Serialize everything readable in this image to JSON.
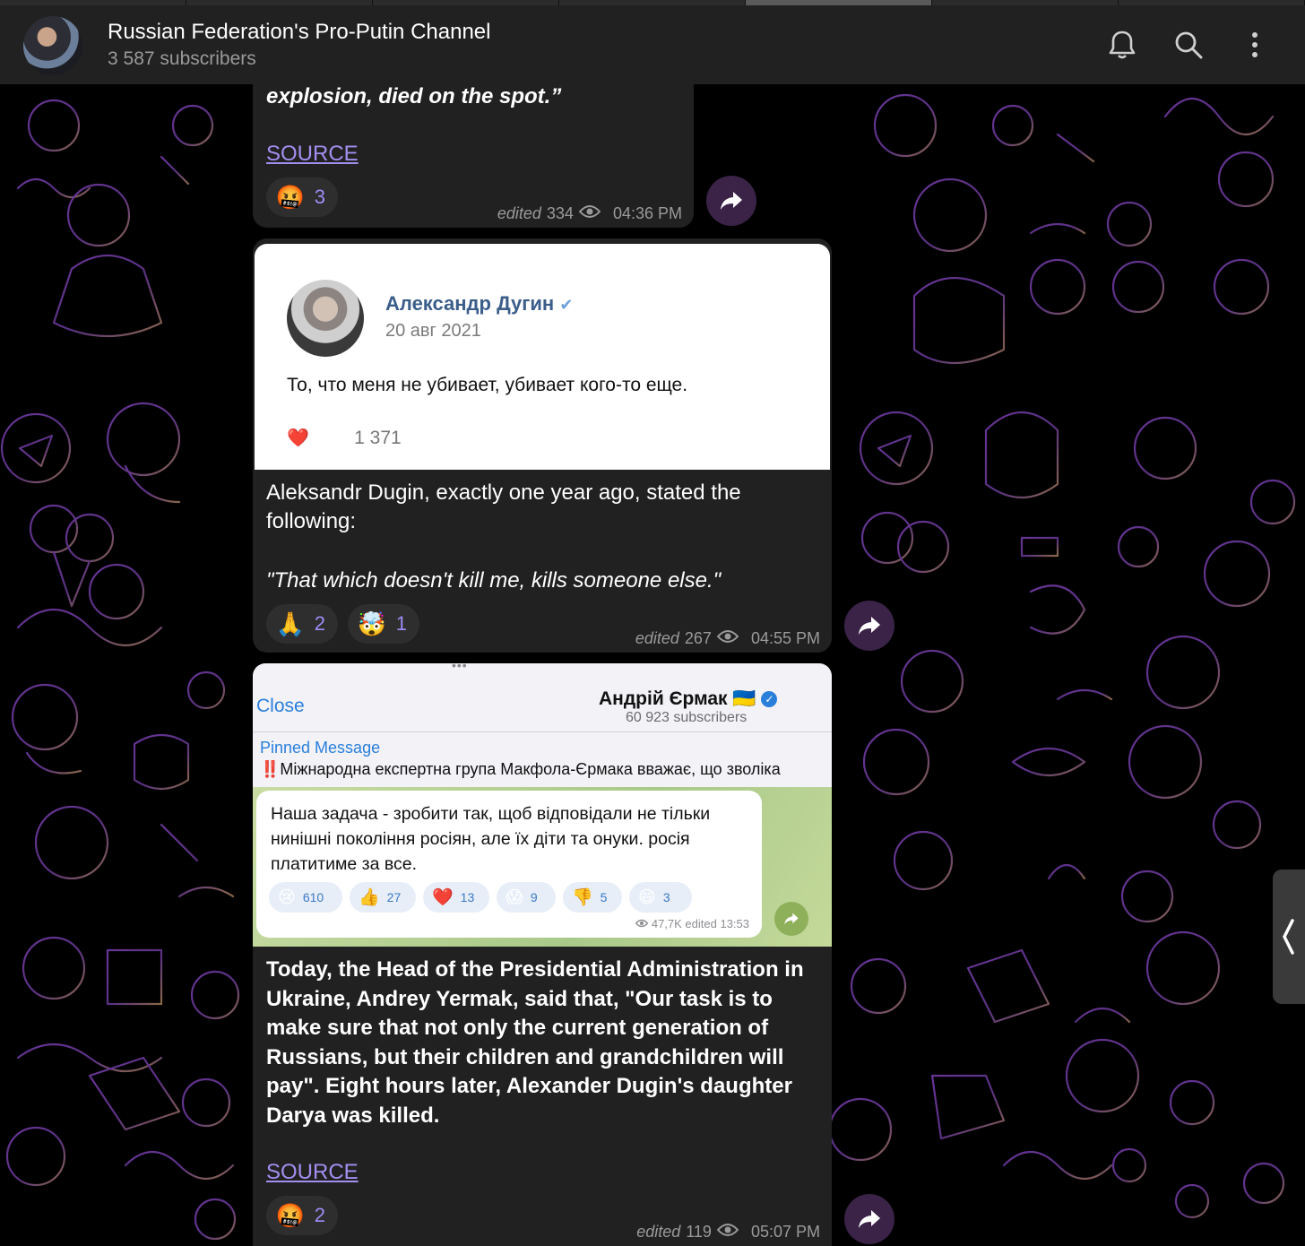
{
  "header": {
    "title": "Russian Federation's Pro-Putin Channel",
    "subtitle": "3 587 subscribers",
    "icons": [
      "bell-icon",
      "search-icon",
      "more-vert-icon"
    ]
  },
  "messages": [
    {
      "text_italic": "explosion, died on the spot.”",
      "source_label": "SOURCE",
      "reactions": [
        {
          "icon": "angry-emoji",
          "emoji": "🤬",
          "count": "3"
        }
      ],
      "edited": "edited",
      "views": "334",
      "time": "04:36 PM"
    },
    {
      "embed": {
        "author": "Александр Дугин",
        "verified": "✔",
        "date": "20 авг 2021",
        "text": "То, что меня не убивает, убивает кого-то еще.",
        "reaction_emojis": [
          "❤️",
          "😮",
          "😂"
        ],
        "reaction_count": "1 371"
      },
      "text_1": "Aleksandr Dugin, exactly one year ago, stated the following:",
      "text_2_italic": "\"That which doesn't kill me, kills someone else.\"",
      "reactions": [
        {
          "icon": "pray-emoji",
          "emoji": "🙏",
          "count": "2"
        },
        {
          "icon": "mind-blown-emoji",
          "emoji": "🤯",
          "count": "1"
        }
      ],
      "edited": "edited",
      "views": "267",
      "time": "04:55 PM"
    },
    {
      "embed": {
        "close_label": "Close",
        "channel_name": "Андрій Єрмак",
        "flag": "🇺🇦",
        "subscribers": "60 923 subscribers",
        "pinned_label": "Pinned Message",
        "pinned_text": "‼️Міжнародна експертна група Макфола-Єрмака вважає, що зволіка",
        "message": "Наша задача - зробити так, щоб відповідали не тільки нинішні покоління росіян, але їх діти та онуки. росія платитиме за все.",
        "reactions": [
          {
            "icon": "crying-emoji",
            "emoji": "😢",
            "count": "610"
          },
          {
            "icon": "thumbs-up-emoji",
            "emoji": "👍",
            "count": "27"
          },
          {
            "icon": "heart-emoji",
            "emoji": "❤️",
            "count": "13"
          },
          {
            "icon": "scream-emoji",
            "emoji": "😱",
            "count": "9"
          },
          {
            "icon": "thumbs-down-emoji",
            "emoji": "👎",
            "count": "5"
          },
          {
            "icon": "grin-emoji",
            "emoji": "😄",
            "count": "3"
          }
        ],
        "meta": "47,7K edited 13:53"
      },
      "text": "Today, the Head of the Presidential Administration in Ukraine, Andrey Yermak, said that, \"Our task is to make sure that not only the current generation of Russians, but their children and grandchildren will pay\". Eight hours later, Alexander Dugin's daughter Darya was killed.",
      "source_label": "SOURCE",
      "reactions": [
        {
          "icon": "angry-emoji",
          "emoji": "🤬",
          "count": "2"
        }
      ],
      "edited": "edited",
      "views": "119",
      "time": "05:07 PM"
    }
  ],
  "colors": {
    "bubble": "#212121",
    "accent": "#9f8cf7",
    "link": "#a48ef0",
    "share_button": "#3a2347"
  }
}
